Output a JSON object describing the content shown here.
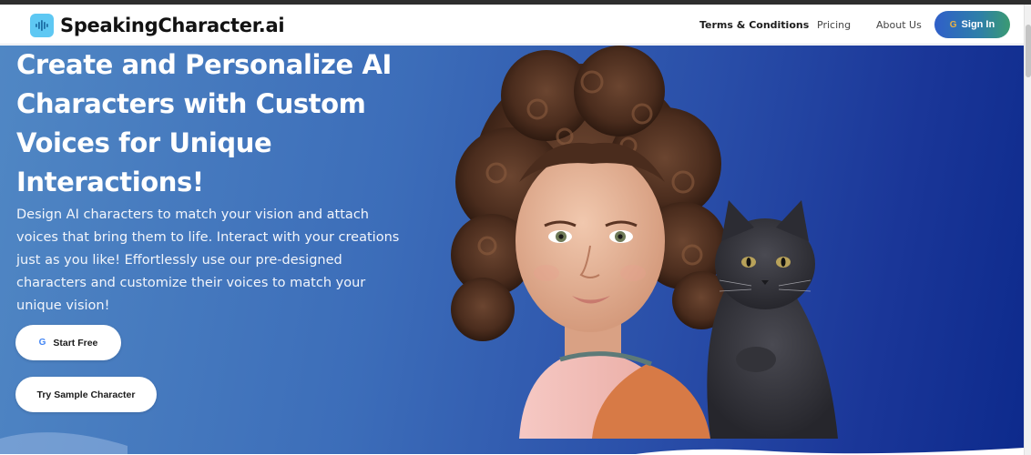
{
  "brand": {
    "name": "SpeakingCharacter.ai",
    "logo_icon": "sound-wave-icon",
    "logo_color": "#5ec8f3"
  },
  "nav": {
    "links": [
      {
        "label": "Terms & Conditions"
      },
      {
        "label": "Pricing"
      },
      {
        "label": "About Us"
      }
    ],
    "signin": {
      "label": "Sign In",
      "icon": "google-g-icon"
    }
  },
  "hero": {
    "headline": "Create and Personalize AI Characters with Custom Voices for Unique Interactions!",
    "subtext": "Design AI characters to match your vision and attach voices that bring them to life. Interact with your creations just as you like! Effortlessly use our pre-designed characters and customize their voices to match your unique vision!",
    "start_button": {
      "label": "Start Free",
      "icon": "google-g-icon"
    },
    "sample_button": {
      "label": "Try Sample Character"
    },
    "image_subject": "curly-haired girl with black cat illustration"
  },
  "colors": {
    "hero_gradient_start": "#5087c4",
    "hero_gradient_end": "#0d2a8c",
    "signin_gradient_start": "#2f5fc9",
    "signin_gradient_end": "#3b9a72"
  }
}
